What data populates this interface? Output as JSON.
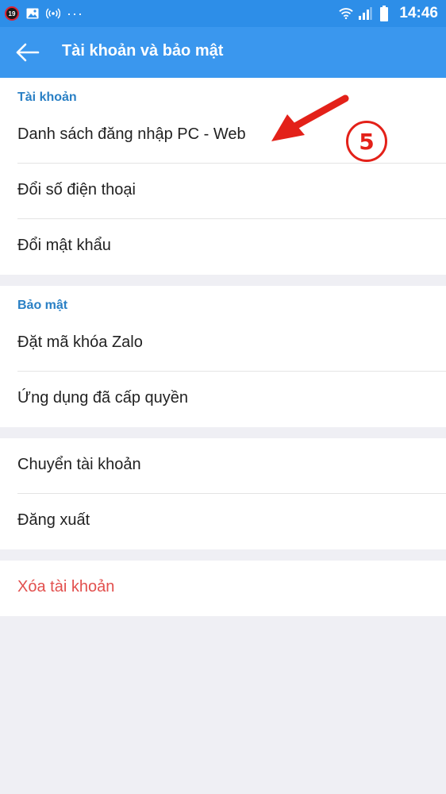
{
  "status_bar": {
    "notification_count": "19",
    "time": "14:46",
    "icons": [
      "notification-badge",
      "image-icon",
      "hotspot-icon",
      "more-dots",
      "wifi-icon",
      "signal-icon",
      "battery-icon"
    ]
  },
  "app_bar": {
    "title": "Tài khoản và bảo mật",
    "back_icon": "arrow-left-icon"
  },
  "sections": {
    "account": {
      "header": "Tài khoản",
      "items": [
        {
          "label": "Danh sách đăng nhập PC - Web"
        },
        {
          "label": "Đổi số điện thoại"
        },
        {
          "label": "Đổi mật khẩu"
        }
      ]
    },
    "security": {
      "header": "Bảo mật",
      "items": [
        {
          "label": "Đặt mã khóa Zalo"
        },
        {
          "label": "Ứng dụng đã cấp quyền"
        }
      ]
    },
    "session": {
      "items": [
        {
          "label": "Chuyển tài khoản"
        },
        {
          "label": "Đăng xuất"
        }
      ]
    },
    "danger": {
      "items": [
        {
          "label": "Xóa tài khoản",
          "color": "#e2504e"
        }
      ]
    }
  },
  "annotation": {
    "step_number": "5",
    "color": "#e32119"
  },
  "colors": {
    "status_bar": "#2d8ee8",
    "app_bar": "#3a97ee",
    "section_header": "#2a80c5",
    "background": "#efeff4"
  }
}
